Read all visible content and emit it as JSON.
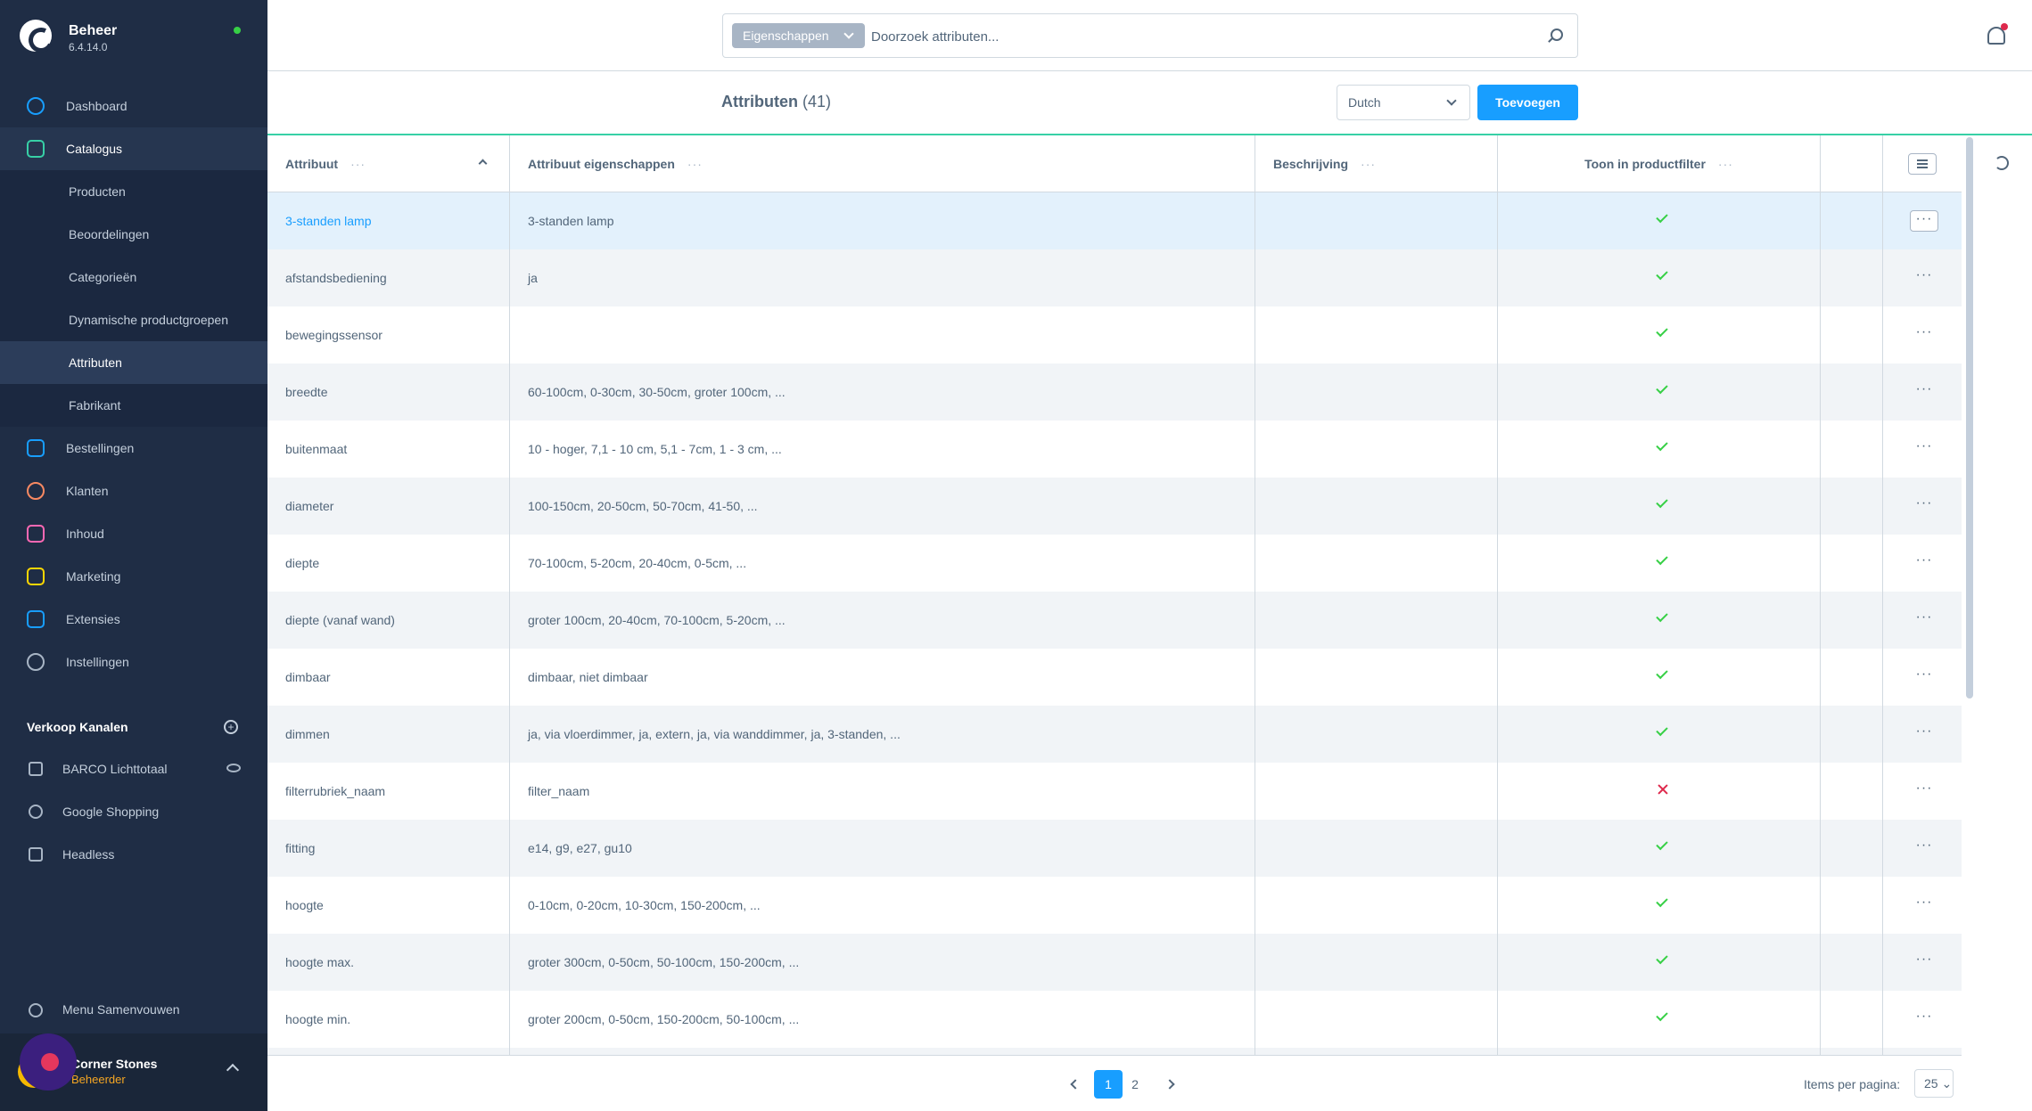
{
  "app": {
    "name": "Beheer",
    "version": "6.4.14.0"
  },
  "nav": [
    {
      "label": "Dashboard"
    },
    {
      "label": "Catalogus"
    },
    {
      "label": "Bestellingen"
    },
    {
      "label": "Klanten"
    },
    {
      "label": "Inhoud"
    },
    {
      "label": "Marketing"
    },
    {
      "label": "Extensies"
    },
    {
      "label": "Instellingen"
    }
  ],
  "subnav": [
    {
      "label": "Producten"
    },
    {
      "label": "Beoordelingen"
    },
    {
      "label": "Categorieën"
    },
    {
      "label": "Dynamische productgroepen"
    },
    {
      "label": "Attributen"
    },
    {
      "label": "Fabrikant"
    }
  ],
  "sales_channels": {
    "title": "Verkoop Kanalen",
    "items": [
      {
        "label": "BARCO Lichttotaal"
      },
      {
        "label": "Google Shopping"
      },
      {
        "label": "Headless"
      }
    ]
  },
  "collapse_label": "Menu Samenvouwen",
  "user": {
    "name": "Corner Stones",
    "role": "Beheerder"
  },
  "search": {
    "type": "Eigenschappen",
    "placeholder": "Doorzoek attributen..."
  },
  "page": {
    "title": "Attributen",
    "count": "(41)",
    "language": "Dutch",
    "add_label": "Toevoegen"
  },
  "columns": {
    "name": "Attribuut",
    "options": "Attribuut eigenschappen",
    "description": "Beschrijving",
    "filterable": "Toon in productfilter"
  },
  "rows": [
    {
      "name": "3-standen lamp",
      "options": "3-standen lamp",
      "filter": true
    },
    {
      "name": "afstandsbediening",
      "options": "ja",
      "filter": true
    },
    {
      "name": "bewegingssensor",
      "options": "",
      "filter": true
    },
    {
      "name": "breedte",
      "options": "60-100cm, 0-30cm, 30-50cm, groter 100cm, ...",
      "filter": true
    },
    {
      "name": "buitenmaat",
      "options": "10 - hoger, 7,1 - 10 cm, 5,1 - 7cm, 1 - 3 cm, ...",
      "filter": true
    },
    {
      "name": "diameter",
      "options": "100-150cm, 20-50cm, 50-70cm, 41-50, ...",
      "filter": true
    },
    {
      "name": "diepte",
      "options": "70-100cm, 5-20cm, 20-40cm, 0-5cm, ...",
      "filter": true
    },
    {
      "name": "diepte (vanaf wand)",
      "options": "groter 100cm, 20-40cm, 70-100cm, 5-20cm, ...",
      "filter": true
    },
    {
      "name": "dimbaar",
      "options": "dimbaar, niet dimbaar",
      "filter": true
    },
    {
      "name": "dimmen",
      "options": "ja, via vloerdimmer, ja, extern, ja, via wanddimmer, ja, 3-standen, ...",
      "filter": true
    },
    {
      "name": "filterrubriek_naam",
      "options": "filter_naam",
      "filter": false
    },
    {
      "name": "fitting",
      "options": "e14, g9, e27, gu10",
      "filter": true
    },
    {
      "name": "hoogte",
      "options": "0-10cm, 0-20cm, 10-30cm, 150-200cm, ...",
      "filter": true
    },
    {
      "name": "hoogte max.",
      "options": "groter 300cm, 0-50cm, 50-100cm, 150-200cm, ...",
      "filter": true
    },
    {
      "name": "hoogte min.",
      "options": "groter 200cm, 0-50cm, 150-200cm, 50-100cm, ...",
      "filter": true
    },
    {
      "name": "",
      "options": "",
      "filter": null
    }
  ],
  "pagination": {
    "pages": [
      "1",
      "2"
    ],
    "current": "1",
    "items_label": "Items per pagina:",
    "items_value": "25"
  },
  "colors": {
    "sidebar": "#1f2d45",
    "accent": "#189eff",
    "success": "#37d046",
    "danger": "#de294c"
  }
}
